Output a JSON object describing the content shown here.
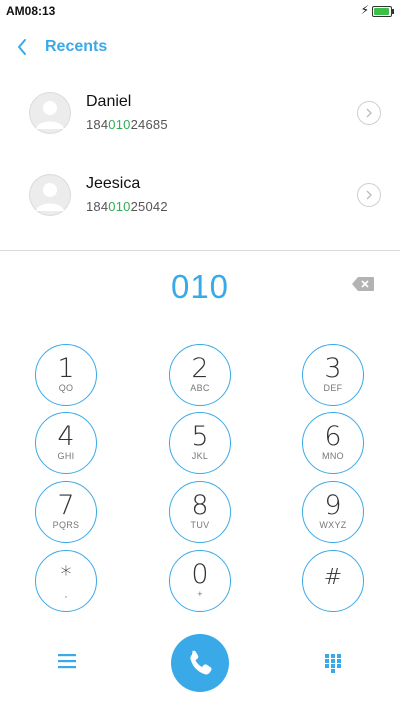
{
  "status_bar": {
    "time": "AM08:13"
  },
  "header": {
    "title": "Recents",
    "back_icon": "chevron-left-icon"
  },
  "recents": [
    {
      "name": "Daniel",
      "number_prefix": "184",
      "number_match": "010",
      "number_suffix": "24685"
    },
    {
      "name": "Jeesica",
      "number_prefix": "184",
      "number_match": "010",
      "number_suffix": "25042"
    }
  ],
  "dial_input": {
    "value": "010"
  },
  "keypad": [
    {
      "digit": "1",
      "letters": "QO"
    },
    {
      "digit": "2",
      "letters": "ABC"
    },
    {
      "digit": "3",
      "letters": "DEF"
    },
    {
      "digit": "4",
      "letters": "GHI"
    },
    {
      "digit": "5",
      "letters": "JKL"
    },
    {
      "digit": "6",
      "letters": "MNO"
    },
    {
      "digit": "7",
      "letters": "PQRS"
    },
    {
      "digit": "8",
      "letters": "TUV"
    },
    {
      "digit": "9",
      "letters": "WXYZ"
    },
    {
      "digit": "*",
      "letters": ","
    },
    {
      "digit": "0",
      "letters": "+"
    },
    {
      "digit": "#",
      "letters": ""
    }
  ],
  "colors": {
    "accent": "#3aa9e8",
    "match": "#2fae55",
    "battery": "#3dc04a"
  }
}
